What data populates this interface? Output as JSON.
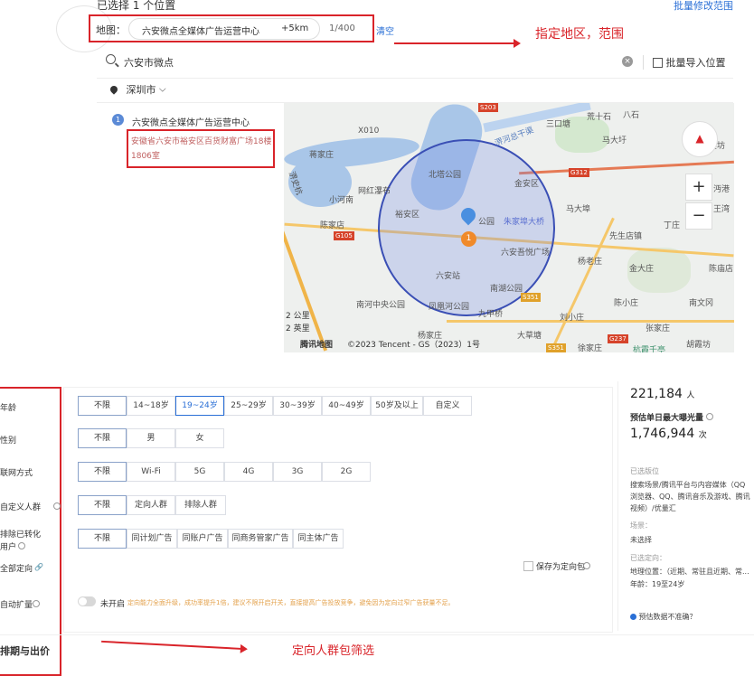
{
  "header": {
    "selected_count": "已选择 1 个位置",
    "batch_edit_link": "批量修改范围"
  },
  "location_bar": {
    "prefix": "地图：",
    "place": "六安微点全媒体广告运营中心",
    "radius": "+5km",
    "count": "1/400",
    "clear": "清空"
  },
  "annotations": {
    "top": "指定地区，范围",
    "bottom": "定向人群包筛选"
  },
  "search": {
    "value": "六安市微点",
    "batch_import": "批量导入位置"
  },
  "city": {
    "name": "深圳市"
  },
  "results": [
    {
      "index": "1",
      "name": "六安微点全媒体广告运营中心",
      "address": "安徽省六安市裕安区百货财富广场18楼1806室"
    }
  ],
  "map": {
    "labels": [
      "X010",
      "荒十石",
      "八石",
      "三口塘",
      "马大圩",
      "蒋家庄",
      "北塔公园",
      "金安区",
      "网红瀑布",
      "小河南",
      "裕安区",
      "朱家埠大桥",
      "马大埠",
      "陈家店",
      "六安吾悦广场",
      "先生店镇",
      "六安站",
      "杨老庄",
      "南湖公园",
      "金大庄",
      "陈庙店",
      "南河中央公园",
      "凤凰河公园",
      "陈小庄",
      "南文冈",
      "刘小庄",
      "张家庄",
      "大草塘",
      "徐家庄",
      "胡霞坊",
      "杭霞千亭",
      "公园",
      "淠河总干渠",
      "丁庄",
      "吴坊",
      "沔港",
      "杨家庄",
      "九甲桥",
      "王湾",
      "淠史杭",
      "S351",
      "G312",
      "G105",
      "S203",
      "S351",
      "G237"
    ],
    "marker_number": "1",
    "scale_km": "2 公里",
    "scale_mi": "2 英里",
    "brand": "腾讯地图",
    "copyright": "©2023 Tencent - GS（2023）1号",
    "zoom_in": "+",
    "zoom_out": "−"
  },
  "filters": {
    "age": {
      "label": "年龄",
      "options": [
        "不限",
        "14~18岁",
        "19~24岁",
        "25~29岁",
        "30~39岁",
        "40~49岁",
        "50岁及以上",
        "自定义"
      ]
    },
    "gender": {
      "label": "性别",
      "options": [
        "不限",
        "男",
        "女"
      ]
    },
    "network": {
      "label": "联网方式",
      "options": [
        "不限",
        "Wi-Fi",
        "5G",
        "4G",
        "3G",
        "2G"
      ]
    },
    "custom_audience": {
      "label": "自定义人群",
      "options": [
        "不限",
        "定向人群",
        "排除人群"
      ]
    },
    "exclude_converted": {
      "label1": "排除已转化",
      "label2": "用户",
      "options": [
        "不限",
        "同计划广告",
        "同账户广告",
        "同商务管家广告",
        "同主体广告"
      ]
    },
    "all_targeting": {
      "label": "全部定向"
    },
    "save_package": "保存为定向包",
    "auto_expand": {
      "label": "自动扩量",
      "toggle": "未开启",
      "note": "定向能力全面升级，成功率提升1倍，建议不限开启开关，直接提高广告投放竞争，避免因为定向过窄广告获量不足。"
    },
    "bidding": "排期与出价"
  },
  "estimate": {
    "audience": "221,184",
    "audience_unit": "人",
    "daily_label": "预估单日最大曝光量",
    "daily": "1,746,944",
    "daily_unit": "次",
    "placement_title": "已选版位",
    "placement_value": "搜索场景/腾讯平台与内容媒体（QQ浏览器、QQ、腾讯音乐及游戏、腾讯视频）/优量汇",
    "scene_title": "场景：",
    "scene_value": "未选择",
    "targeting_title": "已选定向：",
    "targeting_loc": "地理位置：（近期、常驻且近期、常...",
    "targeting_age": "年龄：19至24岁",
    "inaccurate": "预估数据不准确？"
  }
}
